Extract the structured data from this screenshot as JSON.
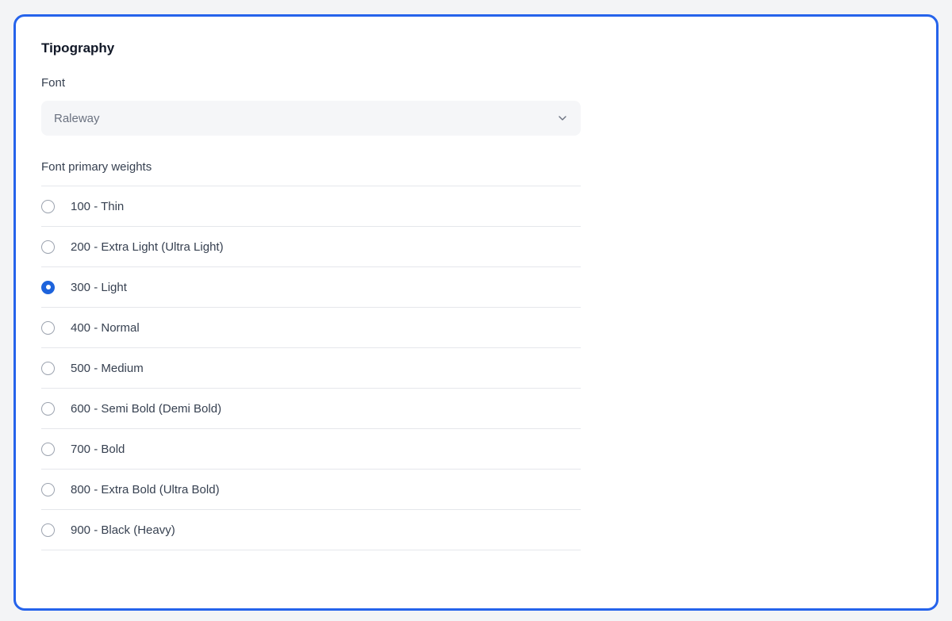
{
  "section": {
    "title": "Tipography"
  },
  "font_field": {
    "label": "Font",
    "selected_value": "Raleway",
    "icon": "chevron-down-icon"
  },
  "weights": {
    "label": "Font primary weights",
    "selected_index": 2,
    "accent_color": "#1d63dc",
    "options": [
      {
        "label": "100 - Thin",
        "checked": false
      },
      {
        "label": "200 - Extra Light (Ultra Light)",
        "checked": false
      },
      {
        "label": "300 - Light",
        "checked": true
      },
      {
        "label": "400 - Normal",
        "checked": false
      },
      {
        "label": "500 - Medium",
        "checked": false
      },
      {
        "label": "600 - Semi Bold (Demi Bold)",
        "checked": false
      },
      {
        "label": "700 - Bold",
        "checked": false
      },
      {
        "label": "800 - Extra Bold (Ultra Bold)",
        "checked": false
      },
      {
        "label": "900 - Black (Heavy)",
        "checked": false
      }
    ]
  },
  "colors": {
    "card_border": "#2563eb",
    "background": "#f3f4f6"
  }
}
